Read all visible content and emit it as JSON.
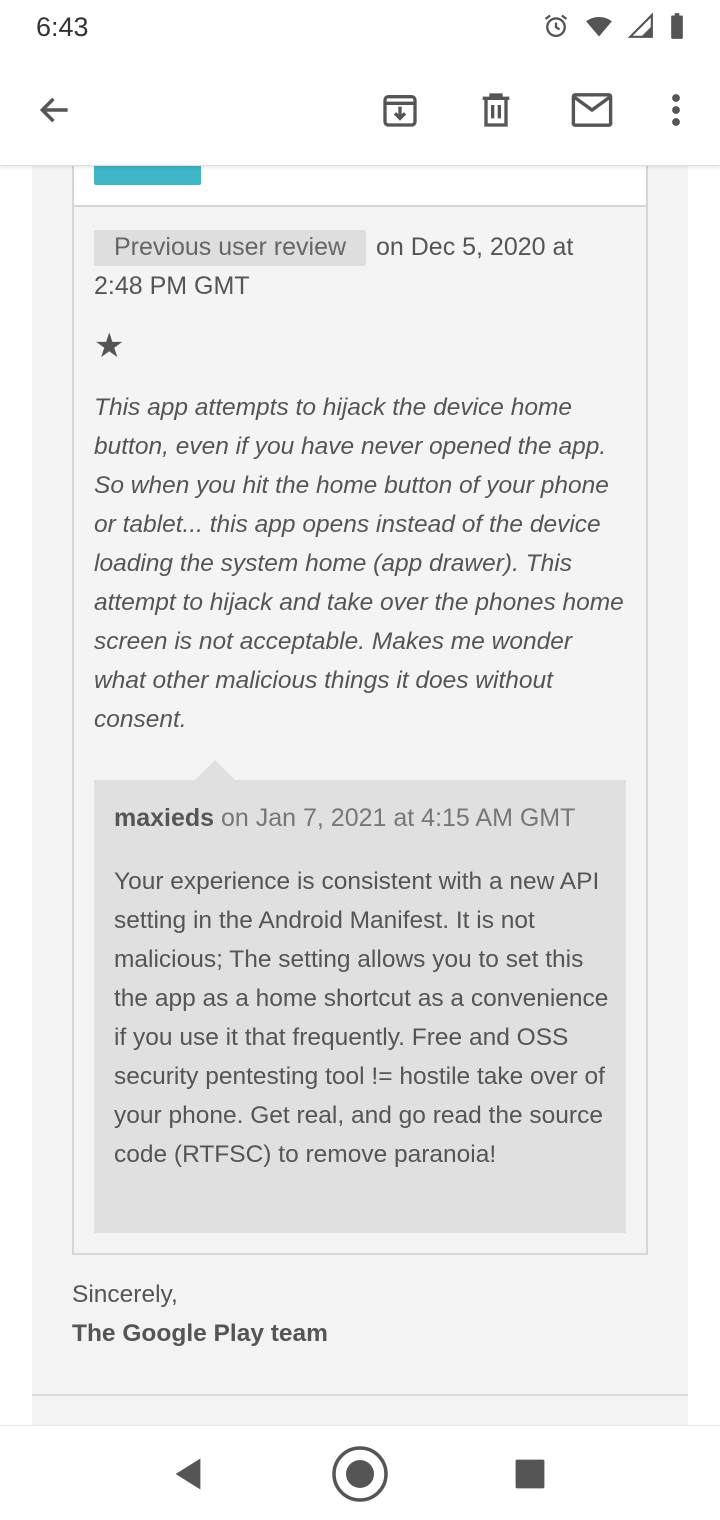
{
  "status_bar": {
    "time": "6:43",
    "icons": [
      "alarm-icon",
      "wifi-icon",
      "signal-icon",
      "battery-icon"
    ]
  },
  "app_bar": {
    "icons": [
      "back-arrow-icon",
      "archive-icon",
      "delete-icon",
      "mark-unread-icon",
      "more-vert-icon"
    ]
  },
  "email": {
    "review": {
      "tag": "Previous user review",
      "date_text": " on Dec 5, 2020 at 2:48 PM GMT",
      "rating_stars": 1,
      "star_glyph": "★",
      "text": "This app attempts to hijack the device home button, even if you have never opened the app. So when you hit the home button of your phone or tablet... this app opens instead of the device loading the system home (app drawer). This attempt to hijack and take over the phones home screen is not acceptable. Makes me wonder what other malicious things it does without consent."
    },
    "developer_reply": {
      "author": "maxieds",
      "date_text": " on Jan 7, 2021 at 4:15 AM GMT",
      "text": "Your experience is consistent with a new API setting in the Android Manifest. It is not malicious; The setting allows you to set this the app as a home shortcut as a convenience if you use it that frequently. Free and OSS security pentesting tool != hostile take over of your phone. Get real, and go read the source code (RTFSC) to remove paranoia!"
    },
    "signoff": {
      "closing": "Sincerely,",
      "team": "The Google Play team"
    }
  },
  "nav_bar": {
    "icons": [
      "back-triangle-icon",
      "home-circle-icon",
      "recents-square-icon"
    ]
  },
  "colors": {
    "accent_button": "#3fb5c8",
    "email_background": "#f3f3f3",
    "reply_background": "#e0e0e0"
  }
}
